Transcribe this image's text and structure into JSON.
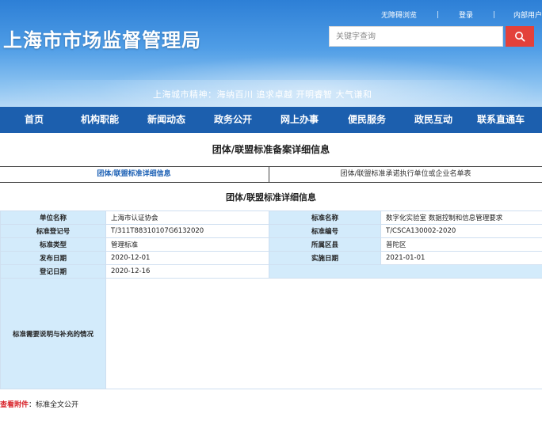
{
  "header": {
    "site_title": "上海市市场监督管理局",
    "top_links": [
      "无障碍浏览",
      "登录",
      "内部用户"
    ],
    "search_placeholder": "关键字查询",
    "slogan": "上海城市精神：海纳百川  追求卓越  开明睿智  大气谦和",
    "colors": {
      "banner": "#2d7fd6",
      "search_button": "#e3413a"
    }
  },
  "nav": {
    "items": [
      "首页",
      "机构职能",
      "新闻动态",
      "政务公开",
      "网上办事",
      "便民服务",
      "政民互动",
      "联系直通车"
    ],
    "color": "#1c5fae"
  },
  "main": {
    "page_title": "团体/联盟标准备案详细信息",
    "tabs": [
      {
        "label": "团体/联盟标准详细信息",
        "active": true
      },
      {
        "label": "团体/联盟标准承诺执行单位或企业名单表",
        "active": false
      }
    ],
    "section_title": "团体/联盟标准详细信息",
    "fields": {
      "unit_name_label": "单位名称",
      "unit_name": "上海市认证协会",
      "std_name_label": "标准名称",
      "std_name": "数字化实验室 数据控制和信息管理要求",
      "reg_no_label": "标准登记号",
      "reg_no": "T/311T88310107G6132020",
      "std_no_label": "标准编号",
      "std_no": "T/CSCA130002-2020",
      "std_type_label": "标准类型",
      "std_type": "管理标准",
      "district_label": "所属区县",
      "district": "普陀区",
      "pub_date_label": "发布日期",
      "pub_date": "2020-12-01",
      "impl_date_label": "实施日期",
      "impl_date": "2021-01-01",
      "reg_date_label": "登记日期",
      "reg_date": "2020-12-16",
      "notes_label": "标准需要说明与补充的情况",
      "notes": ""
    },
    "attachment": {
      "label": "查看附件",
      "separator": "：",
      "link": "标准全文公开"
    },
    "colors": {
      "label_bg": "#d3ebfb",
      "border": "#cfdff0",
      "active_tab": "#1a5fb4"
    }
  }
}
